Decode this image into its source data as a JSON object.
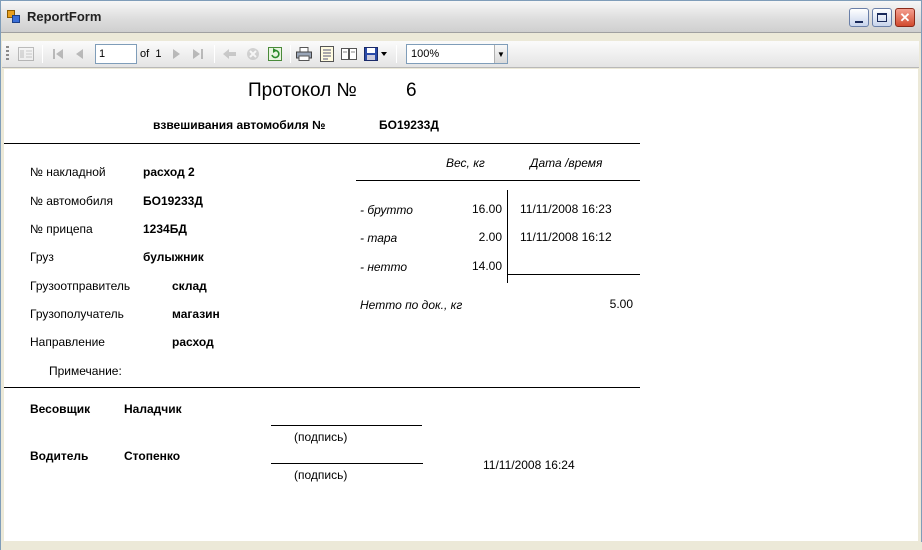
{
  "window": {
    "title": "ReportForm"
  },
  "toolbar": {
    "page_value": "1",
    "of_label": "of",
    "total_pages": "1",
    "zoom": "100%"
  },
  "report": {
    "protocol_label": "Протокол №",
    "protocol_number": "6",
    "weighing_label": "взвешивания автомобиля №",
    "weighing_vehicle": "БО19233Д",
    "fields": [
      {
        "label": "№ накладной",
        "value": "расход 2"
      },
      {
        "label": "№ автомобиля",
        "value": "БО19233Д"
      },
      {
        "label": "№ прицепа",
        "value": "1234БД"
      },
      {
        "label": "Груз",
        "value": "булыжник"
      },
      {
        "label": "Грузоотправитель",
        "value": "склад"
      },
      {
        "label": "Грузополучатель",
        "value": "магазин"
      },
      {
        "label": "Направление",
        "value": "расход"
      }
    ],
    "note_label": "Примечание:",
    "table": {
      "weight_header": "Вес, кг",
      "datetime_header": "Дата /время",
      "rows": [
        {
          "label": "- брутто",
          "weight": "16.00",
          "datetime": "11/11/2008 16:23"
        },
        {
          "label": "- тара",
          "weight": "2.00",
          "datetime": "11/11/2008 16:12"
        },
        {
          "label": "- нетто",
          "weight": "14.00",
          "datetime": ""
        }
      ],
      "netto_doc_label": "Нетто по док., кг",
      "netto_doc_value": "5.00"
    },
    "signatures": {
      "weigher_label": "Весовщик",
      "weigher_name": "Наладчик",
      "driver_label": "Водитель",
      "driver_name": "Стопенко",
      "signature_caption_1": "(подпись)",
      "signature_caption_2": "(подпись)",
      "printed_datetime": "11/11/2008 16:24"
    }
  }
}
